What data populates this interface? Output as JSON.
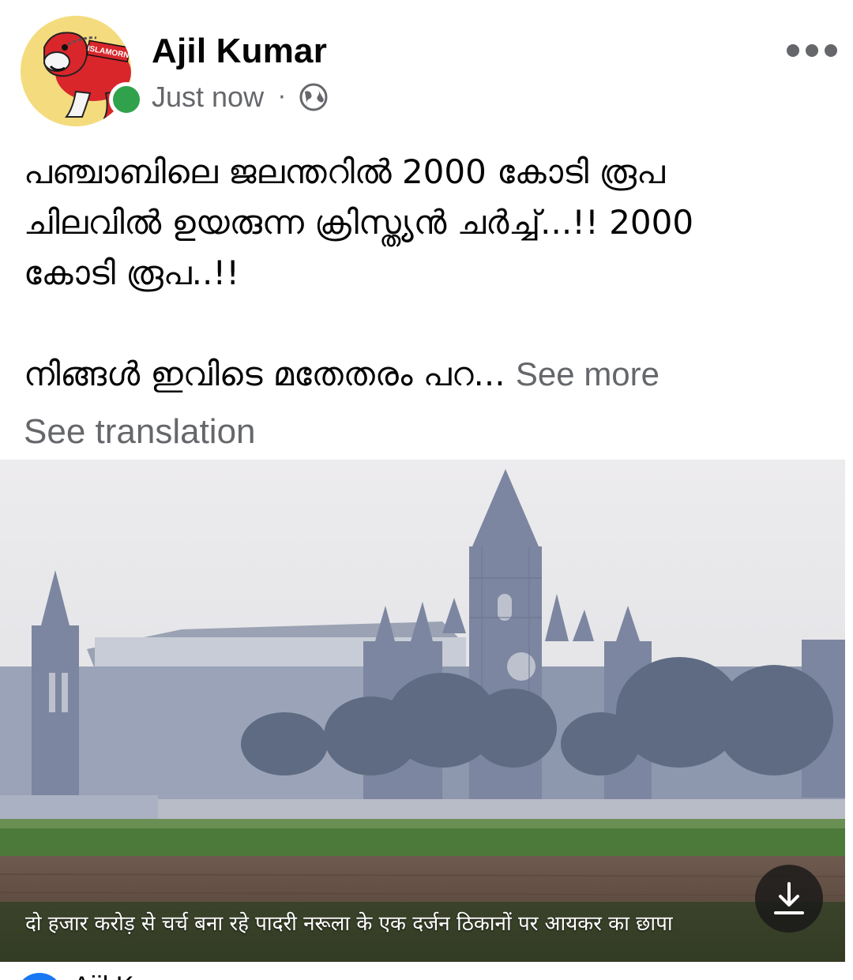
{
  "post": {
    "author": "Ajil Kumar",
    "timestamp": "Just now",
    "separator": "·",
    "privacy_icon": "globe-icon",
    "avatar_text": "ISLAMORN",
    "text_line1": "പഞ്ചാബിലെ ജലന്തറിൽ 2000 കോടി രൂപ",
    "text_line2": "ചിലവിൽ ഉയരുന്ന ക്രിസ്ത്യൻ ചർച്ച്...!! 2000",
    "text_line3": "കോടി രൂപ..!!",
    "text_para2": "നിങ്ങൾ ഇവിടെ മതേതരം പറ...",
    "see_more": "See more",
    "see_translation": "See translation"
  },
  "media": {
    "caption": "दो हजार करोड़ से चर्च बना रहे पादरी नरूला के एक दर्जन ठिकानों पर आयकर का छापा",
    "download_icon": "download-icon"
  },
  "next_post": {
    "author_partial": "Ajil K"
  },
  "colors": {
    "online": "#31a24c",
    "secondary_text": "#65676b",
    "primary_text": "#050505"
  }
}
